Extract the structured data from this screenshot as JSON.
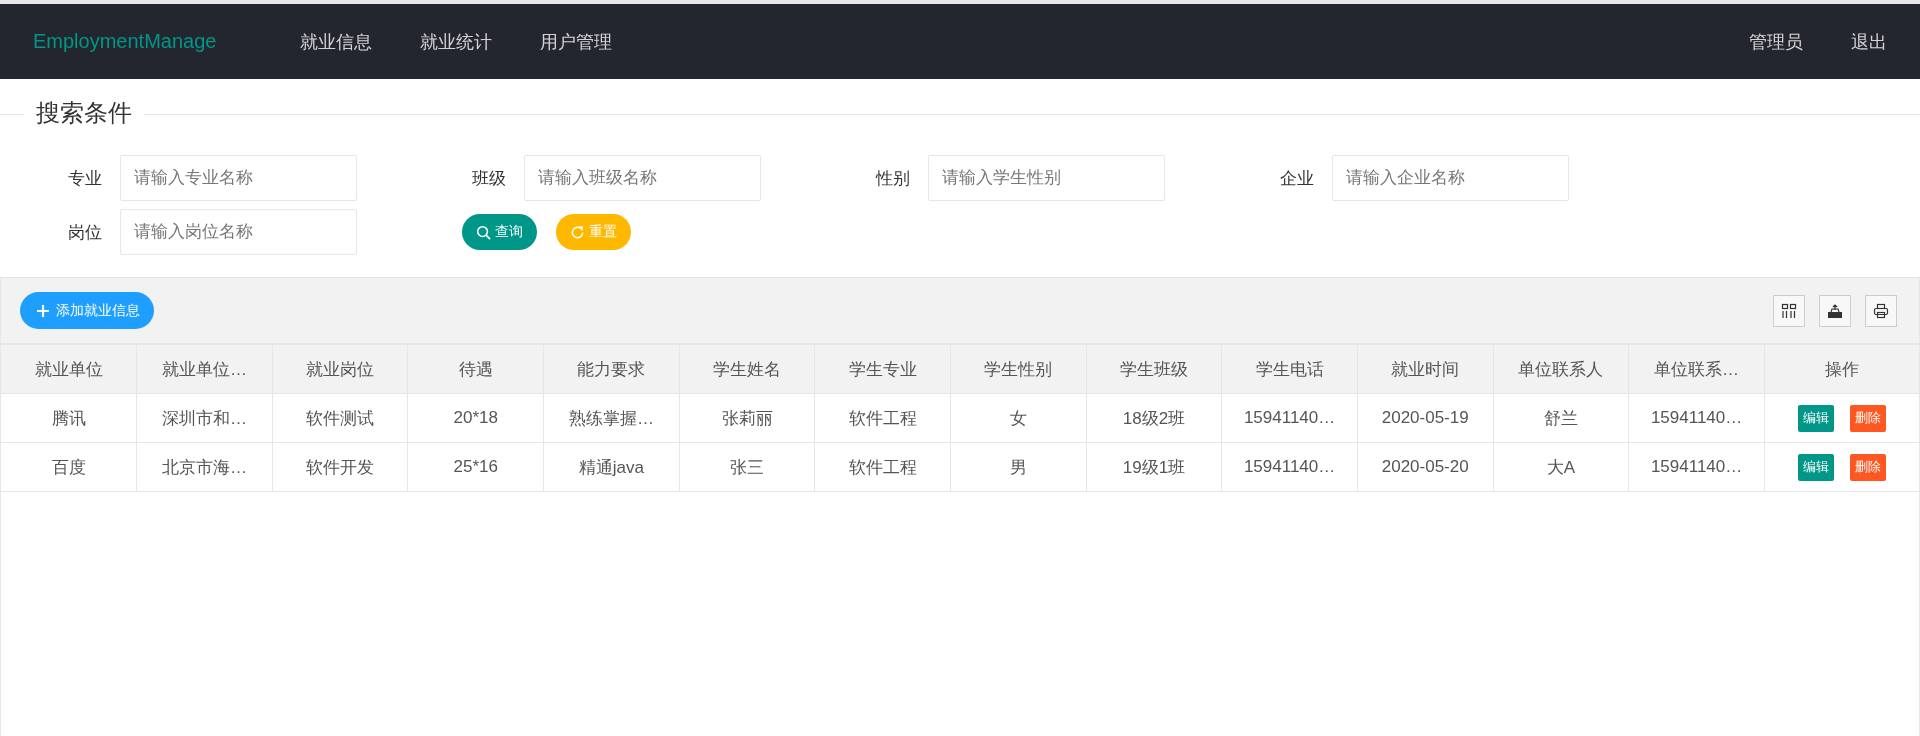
{
  "navbar": {
    "brand": "EmploymentManage",
    "menu": [
      {
        "label": "就业信息"
      },
      {
        "label": "就业统计"
      },
      {
        "label": "用户管理"
      }
    ],
    "user_menu": [
      {
        "label": "管理员"
      },
      {
        "label": "退出"
      }
    ]
  },
  "search": {
    "legend": "搜索条件",
    "fields": [
      {
        "label": "专业",
        "placeholder": "请输入专业名称"
      },
      {
        "label": "班级",
        "placeholder": "请输入班级名称"
      },
      {
        "label": "性别",
        "placeholder": "请输入学生性别"
      },
      {
        "label": "企业",
        "placeholder": "请输入企业名称"
      },
      {
        "label": "岗位",
        "placeholder": "请输入岗位名称"
      }
    ],
    "buttons": [
      {
        "label": "查询",
        "kind": "search"
      },
      {
        "label": "重置",
        "kind": "reset"
      }
    ]
  },
  "toolbar": {
    "add_button": "添加就业信息"
  },
  "table": {
    "columns": [
      "就业单位",
      "就业单位…",
      "就业岗位",
      "待遇",
      "能力要求",
      "学生姓名",
      "学生专业",
      "学生性别",
      "学生班级",
      "学生电话",
      "就业时间",
      "单位联系人",
      "单位联系…",
      "操作"
    ],
    "rows": [
      {
        "cells": [
          "腾讯",
          "深圳市和…",
          "软件测试",
          "20*18",
          "熟练掌握…",
          "张莉丽",
          "软件工程",
          "女",
          "18级2班",
          "15941140…",
          "2020-05-19",
          "舒兰",
          "15941140…"
        ],
        "actions": [
          {
            "label": "编辑",
            "kind": "edit"
          },
          {
            "label": "删除",
            "kind": "delete"
          }
        ]
      },
      {
        "cells": [
          "百度",
          "北京市海…",
          "软件开发",
          "25*16",
          "精通java",
          "张三",
          "软件工程",
          "男",
          "19级1班",
          "15941140…",
          "2020-05-20",
          "大A",
          "15941140…"
        ],
        "actions": [
          {
            "label": "编辑",
            "kind": "edit"
          },
          {
            "label": "删除",
            "kind": "delete"
          }
        ]
      }
    ]
  }
}
